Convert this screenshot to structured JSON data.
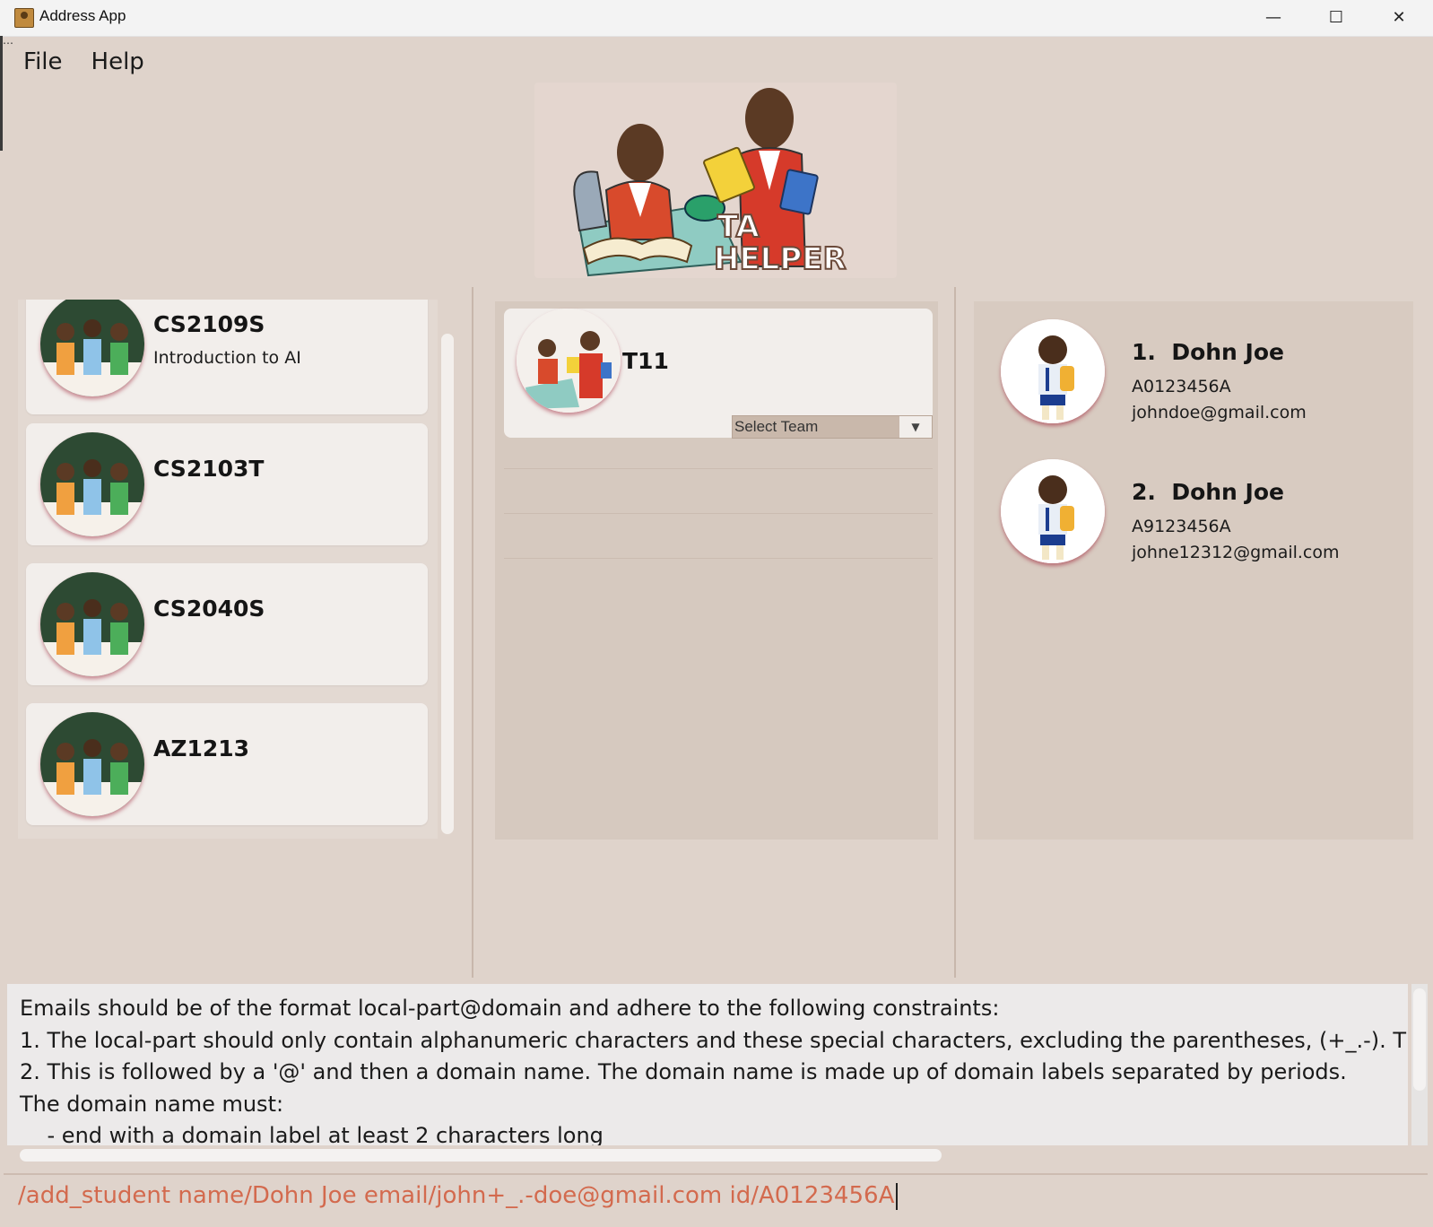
{
  "window": {
    "title": "Address App"
  },
  "menu": {
    "items": [
      "File",
      "Help"
    ]
  },
  "logo": {
    "text_line1": "TA",
    "text_line2": "HELPER"
  },
  "courses": [
    {
      "code": "CS2109S",
      "name": "Introduction to AI"
    },
    {
      "code": "CS2103T",
      "name": ""
    },
    {
      "code": "CS2040S",
      "name": ""
    },
    {
      "code": "AZ1213",
      "name": ""
    }
  ],
  "tutorial": {
    "name": "T11",
    "team_select_placeholder": "Select Team"
  },
  "students": [
    {
      "index": "1.",
      "name": "Dohn Joe",
      "id": "A0123456A",
      "email": "johndoe@gmail.com"
    },
    {
      "index": "2.",
      "name": "Dohn Joe",
      "id": "A9123456A",
      "email": "johne12312@gmail.com"
    }
  ],
  "result": {
    "text": "Emails should be of the format local-part@domain and adhere to the following constraints:\n1. The local-part should only contain alphanumeric characters and these special characters, excluding the parentheses, (+_.-). Tl\n2. This is followed by a '@' and then a domain name. The domain name is made up of domain labels separated by periods.\nThe domain name must:\n    - end with a domain label at least 2 characters long"
  },
  "command": {
    "value": "/add_student name/Dohn Joe email/john+_.-doe@gmail.com id/A0123456A"
  },
  "colors": {
    "background": "#dfd3cb",
    "card": "#f2eeeb",
    "command_text": "#d36a4e",
    "avatar_ring": "#a0283c"
  }
}
